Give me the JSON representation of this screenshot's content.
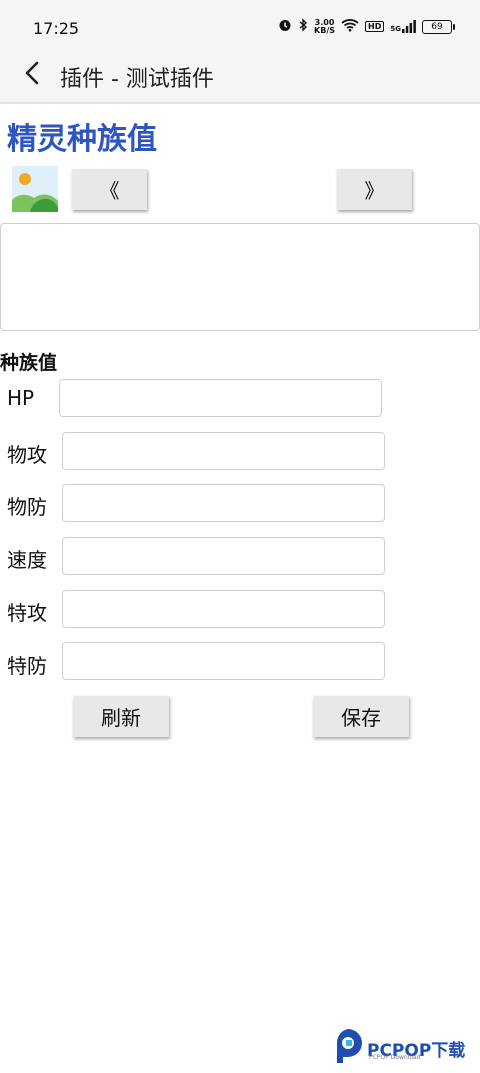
{
  "status_bar": {
    "time": "17:25",
    "speed_value": "3.00",
    "speed_unit": "KB/S",
    "hd": "HD",
    "network": "5G",
    "battery": "69"
  },
  "toolbar": {
    "title": "插件 - 测试插件"
  },
  "page": {
    "title": "精灵种族值",
    "prev_label": "《",
    "next_label": "》",
    "section_label": "种族值"
  },
  "stats": [
    {
      "label": "HP",
      "value": ""
    },
    {
      "label": "物攻",
      "value": ""
    },
    {
      "label": "物防",
      "value": ""
    },
    {
      "label": "速度",
      "value": ""
    },
    {
      "label": "特攻",
      "value": ""
    },
    {
      "label": "特防",
      "value": ""
    }
  ],
  "actions": {
    "refresh_label": "刷新",
    "save_label": "保存"
  },
  "watermark": {
    "text": "PCPOP下载",
    "sub": "PCPOP Download"
  },
  "colors": {
    "title_blue": "#2f56c0",
    "button_gray": "#e8e8e8",
    "field_border": "#cfcfcf"
  }
}
